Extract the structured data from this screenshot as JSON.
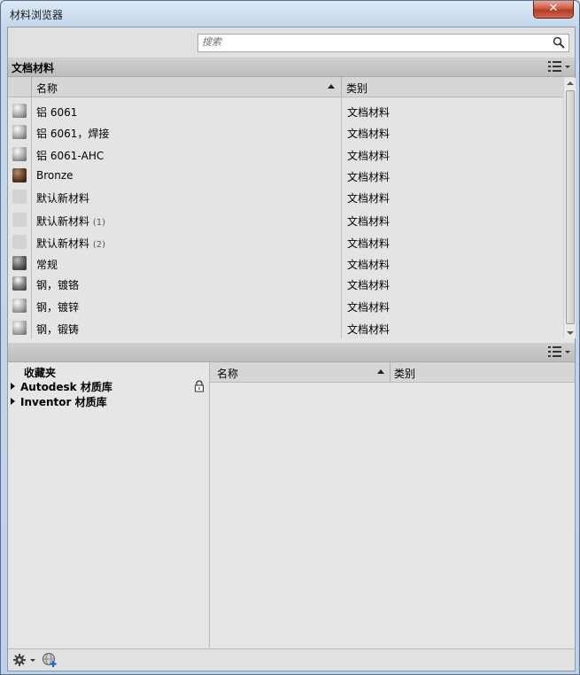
{
  "window": {
    "title": "材料浏览器",
    "close_label": "✕"
  },
  "search": {
    "placeholder": "搜索",
    "value": ""
  },
  "doc_section": {
    "title": "文档材料"
  },
  "doc_table": {
    "columns": [
      "名称",
      "类别"
    ],
    "rows": [
      {
        "name": "铝 6061",
        "suffix": "",
        "category": "文档材料",
        "swatch": "sphere"
      },
      {
        "name": "铝 6061，焊接",
        "suffix": "",
        "category": "文档材料",
        "swatch": "sphere"
      },
      {
        "name": "铝 6061-AHC",
        "suffix": "",
        "category": "文档材料",
        "swatch": "sphere"
      },
      {
        "name": "Bronze",
        "suffix": "",
        "category": "文档材料",
        "swatch": "bronze"
      },
      {
        "name": "默认新材料",
        "suffix": "",
        "category": "文档材料",
        "swatch": "blank"
      },
      {
        "name": "默认新材料",
        "suffix": "(1)",
        "category": "文档材料",
        "swatch": "blank"
      },
      {
        "name": "默认新材料",
        "suffix": "(2)",
        "category": "文档材料",
        "swatch": "blank"
      },
      {
        "name": "常规",
        "suffix": "",
        "category": "文档材料",
        "swatch": "dark"
      },
      {
        "name": "钢，镀铬",
        "suffix": "",
        "category": "文档材料",
        "swatch": "gloss"
      },
      {
        "name": "钢，镀锌",
        "suffix": "",
        "category": "文档材料",
        "swatch": "sphere"
      },
      {
        "name": "钢，锻铸",
        "suffix": "",
        "category": "文档材料",
        "swatch": "sphere"
      }
    ]
  },
  "library_tree": {
    "favorites": "收藏夹",
    "libraries": [
      {
        "label": "Autodesk 材质库",
        "locked": true
      },
      {
        "label": "Inventor 材质库",
        "locked": false
      }
    ]
  },
  "library_table": {
    "columns": [
      "名称",
      "类别"
    ]
  },
  "icons": {
    "search": "search-icon",
    "view_toggle": "list-view-icon",
    "lock": "lock-icon",
    "settings": "gear-icon",
    "add_library": "add-library-icon"
  }
}
